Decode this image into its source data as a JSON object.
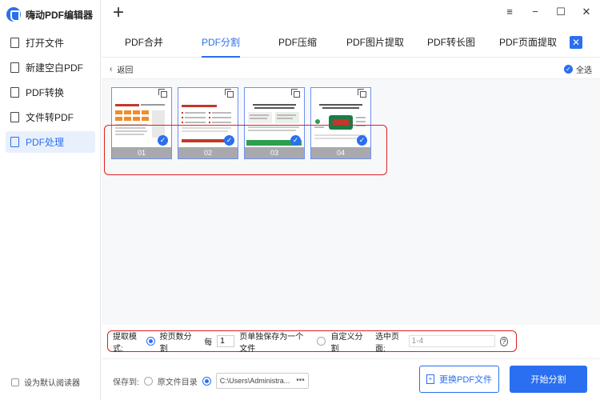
{
  "app": {
    "title": "嗨动PDF编辑器"
  },
  "sidebar": {
    "items": [
      {
        "label": "打开文件",
        "icon": "folder-icon"
      },
      {
        "label": "新建空白PDF",
        "icon": "image-file-icon"
      },
      {
        "label": "PDF转换",
        "icon": "pdf-convert-icon"
      },
      {
        "label": "文件转PDF",
        "icon": "file-to-pdf-icon"
      },
      {
        "label": "PDF处理",
        "icon": "pdf-process-icon",
        "active": true
      }
    ],
    "default_reader_label": "设为默认阅读器"
  },
  "tabs": [
    {
      "label": "PDF合并"
    },
    {
      "label": "PDF分割",
      "active": true
    },
    {
      "label": "PDF压缩"
    },
    {
      "label": "PDF图片提取"
    },
    {
      "label": "PDF转长图"
    },
    {
      "label": "PDF页面提取"
    }
  ],
  "subhead": {
    "back_label": "返回",
    "select_all_label": "全选"
  },
  "pages": [
    {
      "num": "01",
      "title": "门店管理工作 · 营业数据统计汇总"
    },
    {
      "num": "02",
      "title": "2023年年度运营数据分析报告"
    },
    {
      "num": "03",
      "title": "IMPROVE OPERATIONAL EFFICIENCY AND STRENGTHEN TEAM COLLABORATION"
    },
    {
      "num": "04",
      "title": "BUILD SYSTEMATIC MANAGEMENT PROCESS"
    }
  ],
  "options": {
    "mode_label": "提取模式:",
    "by_page_label": "按页数分割",
    "every_label": "每",
    "every_value": "1",
    "save_label": "页单独保存为一个文件",
    "custom_label": "自定义分割",
    "selected_label": "选中页面:",
    "selected_value": "1-4"
  },
  "bottom": {
    "save_to_label": "保存到:",
    "source_dir_label": "原文件目录",
    "path": "C:\\Users\\Administra...",
    "change_button": "更换PDF文件",
    "start_button": "开始分割"
  },
  "colors": {
    "accent": "#2a6ff0",
    "highlight": "#e02020"
  }
}
